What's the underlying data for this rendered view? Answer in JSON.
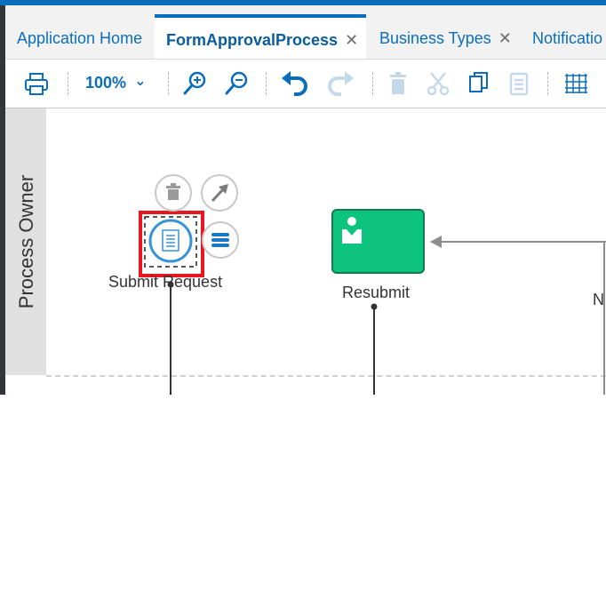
{
  "tabs": [
    {
      "label": "Application Home",
      "active": false,
      "closable": false
    },
    {
      "label": "FormApprovalProcess",
      "active": true,
      "closable": true
    },
    {
      "label": "Business Types",
      "active": false,
      "closable": true
    },
    {
      "label": "Notificatio",
      "active": false,
      "closable": false
    }
  ],
  "close_glyph": "✕",
  "toolbar": {
    "zoom_level": "100%",
    "chevron_glyph": "⌄",
    "icons": [
      "print-icon",
      "zoom-in-icon",
      "zoom-out-icon",
      "undo-icon",
      "redo-icon",
      "delete-icon",
      "cut-icon",
      "copy-icon",
      "paste-icon",
      "grid-icon"
    ]
  },
  "canvas": {
    "lane_title": "Process Owner",
    "nodes": {
      "submit_request": "Submit Request",
      "resubmit": "Resubmit",
      "partial_label": "N"
    }
  },
  "colors": {
    "accent": "#0a6ebd",
    "task_green": "#0dc47e",
    "selection_red": "#e8171f"
  }
}
